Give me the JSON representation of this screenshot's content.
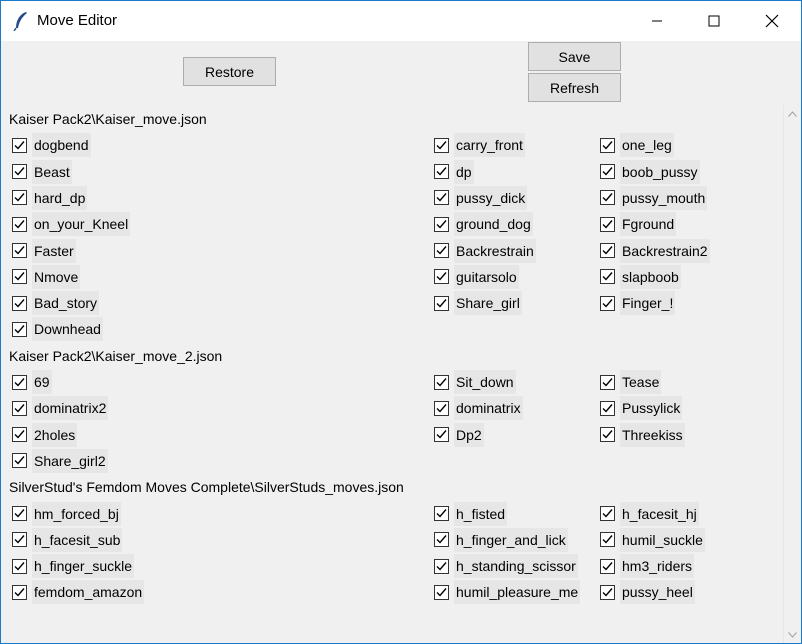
{
  "window": {
    "title": "Move Editor"
  },
  "toolbar": {
    "restore_label": "Restore",
    "save_label": "Save",
    "refresh_label": "Refresh"
  },
  "groups": [
    {
      "label": "Kaiser Pack2\\Kaiser_move.json",
      "items": [
        {
          "label": "dogbend",
          "checked": true
        },
        {
          "label": "carry_front",
          "checked": true
        },
        {
          "label": "one_leg",
          "checked": true
        },
        {
          "label": "Beast",
          "checked": true
        },
        {
          "label": "dp",
          "checked": true
        },
        {
          "label": "boob_pussy",
          "checked": true
        },
        {
          "label": "hard_dp",
          "checked": true
        },
        {
          "label": "pussy_dick",
          "checked": true
        },
        {
          "label": "pussy_mouth",
          "checked": true
        },
        {
          "label": "on_your_Kneel",
          "checked": true
        },
        {
          "label": "ground_dog",
          "checked": true
        },
        {
          "label": "Fground",
          "checked": true
        },
        {
          "label": "Faster",
          "checked": true
        },
        {
          "label": "Backrestrain",
          "checked": true
        },
        {
          "label": "Backrestrain2",
          "checked": true
        },
        {
          "label": "Nmove",
          "checked": true
        },
        {
          "label": "guitarsolo",
          "checked": true
        },
        {
          "label": "slapboob",
          "checked": true
        },
        {
          "label": "Bad_story",
          "checked": true
        },
        {
          "label": "Share_girl",
          "checked": true
        },
        {
          "label": "Finger_!",
          "checked": true
        },
        {
          "label": "Downhead",
          "checked": true
        }
      ]
    },
    {
      "label": "Kaiser Pack2\\Kaiser_move_2.json",
      "items": [
        {
          "label": "69",
          "checked": true
        },
        {
          "label": "Sit_down",
          "checked": true
        },
        {
          "label": "Tease",
          "checked": true
        },
        {
          "label": "dominatrix2",
          "checked": true
        },
        {
          "label": "dominatrix",
          "checked": true
        },
        {
          "label": "Pussylick",
          "checked": true
        },
        {
          "label": "2holes",
          "checked": true
        },
        {
          "label": "Dp2",
          "checked": true
        },
        {
          "label": "Threekiss",
          "checked": true
        },
        {
          "label": "Share_girl2",
          "checked": true
        }
      ]
    },
    {
      "label": "SilverStud's Femdom Moves Complete\\SilverStuds_moves.json",
      "items": [
        {
          "label": "hm_forced_bj",
          "checked": true
        },
        {
          "label": "h_fisted",
          "checked": true
        },
        {
          "label": "h_facesit_hj",
          "checked": true
        },
        {
          "label": "h_facesit_sub",
          "checked": true
        },
        {
          "label": "h_finger_and_lick",
          "checked": true
        },
        {
          "label": "humil_suckle",
          "checked": true
        },
        {
          "label": "h_finger_suckle",
          "checked": true
        },
        {
          "label": "h_standing_scissor",
          "checked": true
        },
        {
          "label": "hm3_riders",
          "checked": true
        },
        {
          "label": "femdom_amazon",
          "checked": true
        },
        {
          "label": "humil_pleasure_me",
          "checked": true
        },
        {
          "label": "pussy_heel",
          "checked": true
        }
      ]
    }
  ]
}
